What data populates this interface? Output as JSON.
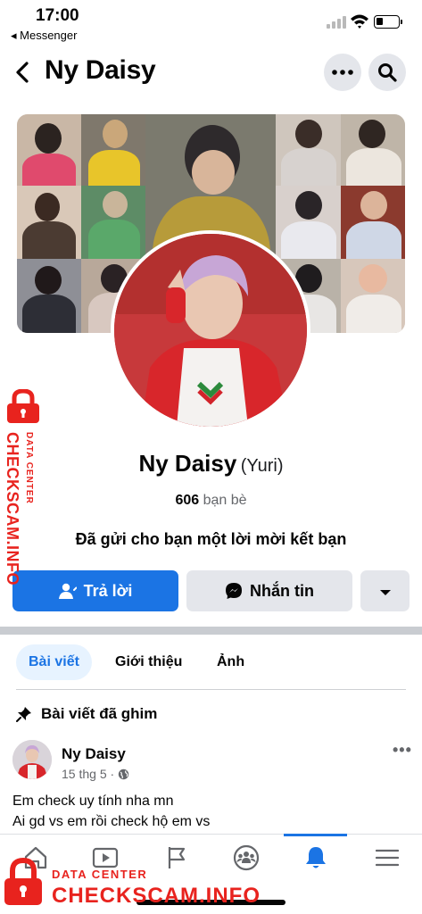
{
  "status_bar": {
    "time": "17:00",
    "back_app": "◂ Messenger"
  },
  "header": {
    "title": "Ny Daisy"
  },
  "profile": {
    "name": "Ny Daisy",
    "alt_name": "(Yuri)",
    "friends_count": "606",
    "friends_label": "bạn bè",
    "request_text": "Đã gửi cho bạn một lời mời kết bạn"
  },
  "actions": {
    "reply_label": "Trả lời",
    "message_label": "Nhắn tin"
  },
  "tabs": [
    {
      "label": "Bài viết",
      "active": true
    },
    {
      "label": "Giới thiệu",
      "active": false
    },
    {
      "label": "Ảnh",
      "active": false
    }
  ],
  "pinned": {
    "label": "Bài viết đã ghim"
  },
  "post": {
    "author": "Ny Daisy",
    "date": "15 thg 5 ·",
    "lines": [
      "Em check uy tính nha mn",
      "Ai gd vs em rồi check hộ em vs"
    ]
  },
  "watermark": {
    "side_small": "DATA CENTER",
    "side_big": "CHECKSCAM.INFO",
    "bottom_small": "DATA CENTER",
    "bottom_big": "CHECKSCAM.INFO"
  },
  "colors": {
    "accent": "#1b74e4",
    "watermark": "#e8231e",
    "muted": "#65676b"
  },
  "icons": {
    "header": [
      "back-icon",
      "more-icon",
      "search-icon"
    ],
    "bottom_nav": [
      "home-icon",
      "video-icon",
      "pages-flag-icon",
      "groups-icon",
      "notifications-bell-icon",
      "menu-icon"
    ],
    "bottom_nav_active": "notifications-bell-icon"
  }
}
